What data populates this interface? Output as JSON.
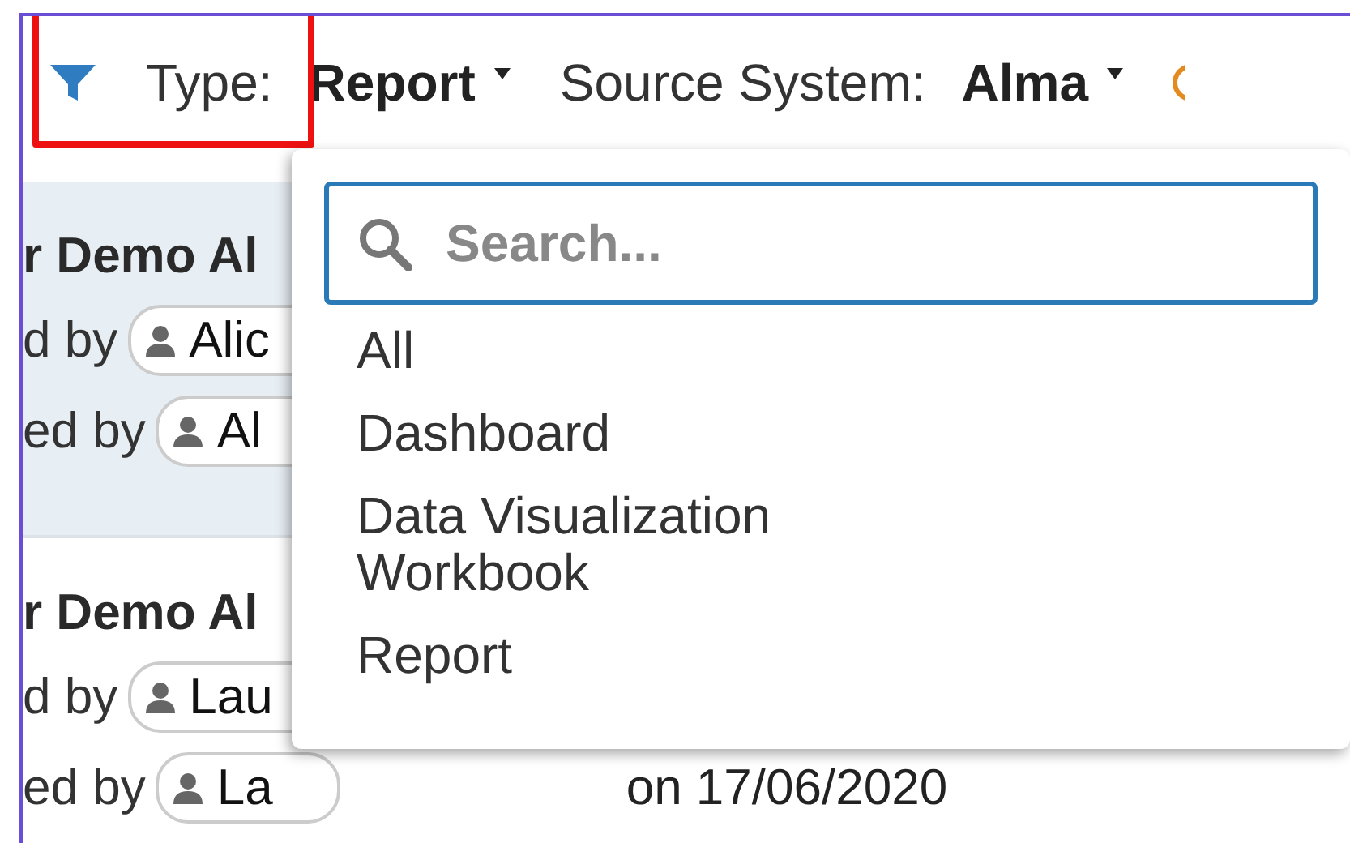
{
  "filter_bar": {
    "filters": [
      {
        "label": "Type:",
        "value": "Report",
        "highlighted": true
      },
      {
        "label": "Source System:",
        "value": "Alma",
        "highlighted": false
      }
    ]
  },
  "cards": [
    {
      "title": "r Demo Al",
      "selected": true,
      "rows": [
        {
          "label": "d by",
          "user": "Alic"
        },
        {
          "label": "ed by",
          "user": "Al"
        }
      ]
    },
    {
      "title": "r Demo Al",
      "selected": false,
      "rows": [
        {
          "label": "d by",
          "user": "Lau"
        },
        {
          "label": "ed by",
          "user": "La",
          "date": "on 17/06/2020"
        }
      ]
    }
  ],
  "dropdown": {
    "search": {
      "placeholder": "Search..."
    },
    "options": [
      "All",
      "Dashboard",
      "Data Visualization Workbook",
      "Report"
    ]
  }
}
